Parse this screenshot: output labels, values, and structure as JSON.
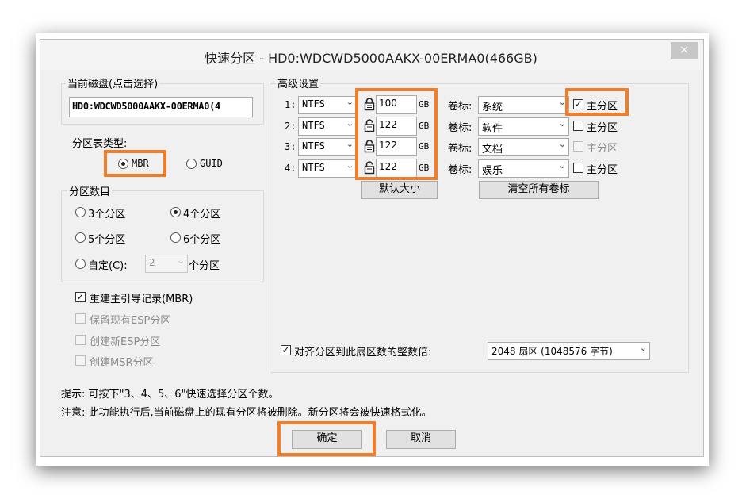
{
  "window": {
    "title": "快速分区 - HD0:WDCWD5000AAKX-00ERMA0(466GB)",
    "close": "×"
  },
  "disk": {
    "label": "当前磁盘(点击选择)",
    "value": "HD0:WDCWD5000AAKX-00ERMA0(4"
  },
  "partition_table": {
    "label": "分区表类型:",
    "options": [
      "MBR",
      "GUID"
    ],
    "selected": "MBR"
  },
  "partition_count": {
    "label": "分区数目",
    "options": [
      "3个分区",
      "4个分区",
      "5个分区",
      "6个分区"
    ],
    "selected": "4个分区",
    "custom_label": "自定(C):",
    "custom_value": "2",
    "custom_suffix": "个分区"
  },
  "checkboxes": [
    {
      "label": "重建主引导记录(MBR)",
      "checked": true,
      "enabled": true
    },
    {
      "label": "保留现有ESP分区",
      "checked": false,
      "enabled": false
    },
    {
      "label": "创建新ESP分区",
      "checked": false,
      "enabled": false
    },
    {
      "label": "创建MSR分区",
      "checked": false,
      "enabled": false
    }
  ],
  "advanced": {
    "label": "高级设置",
    "rows": [
      {
        "index": "1:",
        "fs": "NTFS",
        "locked": true,
        "size": "100",
        "unit": "GB",
        "vol_label_caption": "卷标:",
        "vol_label": "系统",
        "primary_label": "主分区",
        "primary": true,
        "primary_enabled": true
      },
      {
        "index": "2:",
        "fs": "NTFS",
        "locked": false,
        "size": "122",
        "unit": "GB",
        "vol_label_caption": "卷标:",
        "vol_label": "软件",
        "primary_label": "主分区",
        "primary": false,
        "primary_enabled": true
      },
      {
        "index": "3:",
        "fs": "NTFS",
        "locked": false,
        "size": "122",
        "unit": "GB",
        "vol_label_caption": "卷标:",
        "vol_label": "文档",
        "primary_label": "主分区",
        "primary": false,
        "primary_enabled": false
      },
      {
        "index": "4:",
        "fs": "NTFS",
        "locked": false,
        "size": "122",
        "unit": "GB",
        "vol_label_caption": "卷标:",
        "vol_label": "娱乐",
        "primary_label": "主分区",
        "primary": false,
        "primary_enabled": true
      }
    ],
    "default_size_button": "默认大小",
    "clear_labels_button": "清空所有卷标",
    "align_label": "对齐分区到此扇区数的整数倍:",
    "align_checked": true,
    "align_value": "2048 扇区 (1048576 字节)"
  },
  "hints": {
    "tip": "提示: 可按下\"3、4、5、6\"快速选择分区个数。",
    "note": "注意: 此功能执行后,当前磁盘上的现有分区将被删除。新分区将会被快速格式化。"
  },
  "buttons": {
    "ok": "确定",
    "cancel": "取消"
  },
  "colors": {
    "highlight": "#f07d2a",
    "dialog_bg": "#f0f0f0",
    "close_button": "#c7c7c7"
  }
}
